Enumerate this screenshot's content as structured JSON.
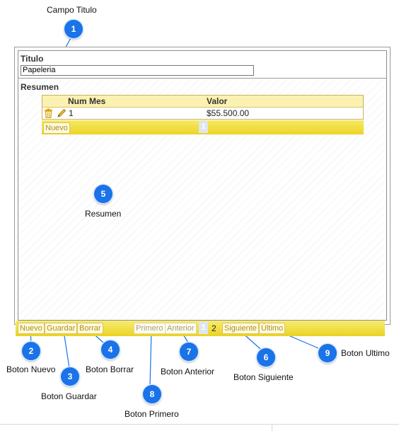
{
  "annotations": {
    "campo_titulo": "Campo Titulo",
    "resumen": "Resumen",
    "boton_nuevo": "Boton Nuevo",
    "boton_guardar": "Boton Guardar",
    "boton_borrar": "Boton Borrar",
    "boton_primero": "Boton Primero",
    "boton_anterior": "Boton Anterior",
    "boton_siguiente": "Boton Siguiente",
    "boton_ultimo": "Boton Ultimo"
  },
  "markers": [
    "1",
    "2",
    "3",
    "4",
    "5",
    "6",
    "7",
    "8",
    "9"
  ],
  "form": {
    "titulo_label": "Titulo",
    "titulo_value": "Papeleria",
    "resumen_label": "Resumen"
  },
  "grid": {
    "columns": [
      "Num Mes",
      "Valor"
    ],
    "rows": [
      {
        "num_mes": "1",
        "valor": "$55.500.00"
      }
    ],
    "nuevo_label": "Nuevo",
    "current_page": "1"
  },
  "pager": {
    "nuevo": "Nuevo",
    "guardar": "Guardar",
    "borrar": "Borrar",
    "primero": "Primero",
    "anterior": "Anterior",
    "page_current": "1",
    "page_next": "2",
    "siguiente": "Siguiente",
    "ultimo": "Último"
  },
  "colors": {
    "marker": "#1a73e8",
    "toolbar": "#f0dc3a",
    "grid_header": "#fbf1b0"
  },
  "icons": [
    "trash-icon",
    "pencil-icon"
  ]
}
